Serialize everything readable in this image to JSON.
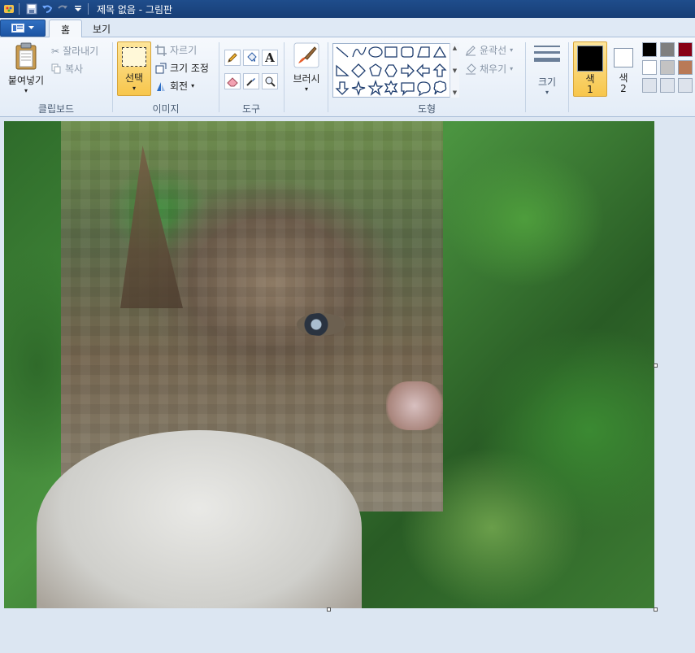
{
  "window": {
    "title": "제목 없음 - 그림판"
  },
  "tabs": {
    "home": "홈",
    "view": "보기"
  },
  "clipboard": {
    "label": "클립보드",
    "paste": "붙여넣기",
    "cut": "잘라내기",
    "copy": "복사"
  },
  "image": {
    "label": "이미지",
    "select": "선택",
    "crop": "자르기",
    "resize": "크기 조정",
    "rotate": "회전"
  },
  "tools": {
    "label": "도구"
  },
  "brushes": {
    "label": "브러시"
  },
  "shapes": {
    "label": "도형",
    "outline": "윤곽선",
    "fill": "채우기"
  },
  "size": {
    "label": "크기"
  },
  "colors": {
    "color1_label": "색",
    "color1_num": "1",
    "color2_label": "색",
    "color2_num": "2",
    "color1": "#000000",
    "color2": "#ffffff",
    "palette_row1": [
      "#000000",
      "#7f7f7f",
      "#880015"
    ],
    "palette_row2": [
      "#ffffff",
      "#c3c3c3",
      "#b97a57"
    ],
    "palette_row3": [
      "#dde3ec",
      "#dde3ec",
      "#dde3ec"
    ]
  }
}
